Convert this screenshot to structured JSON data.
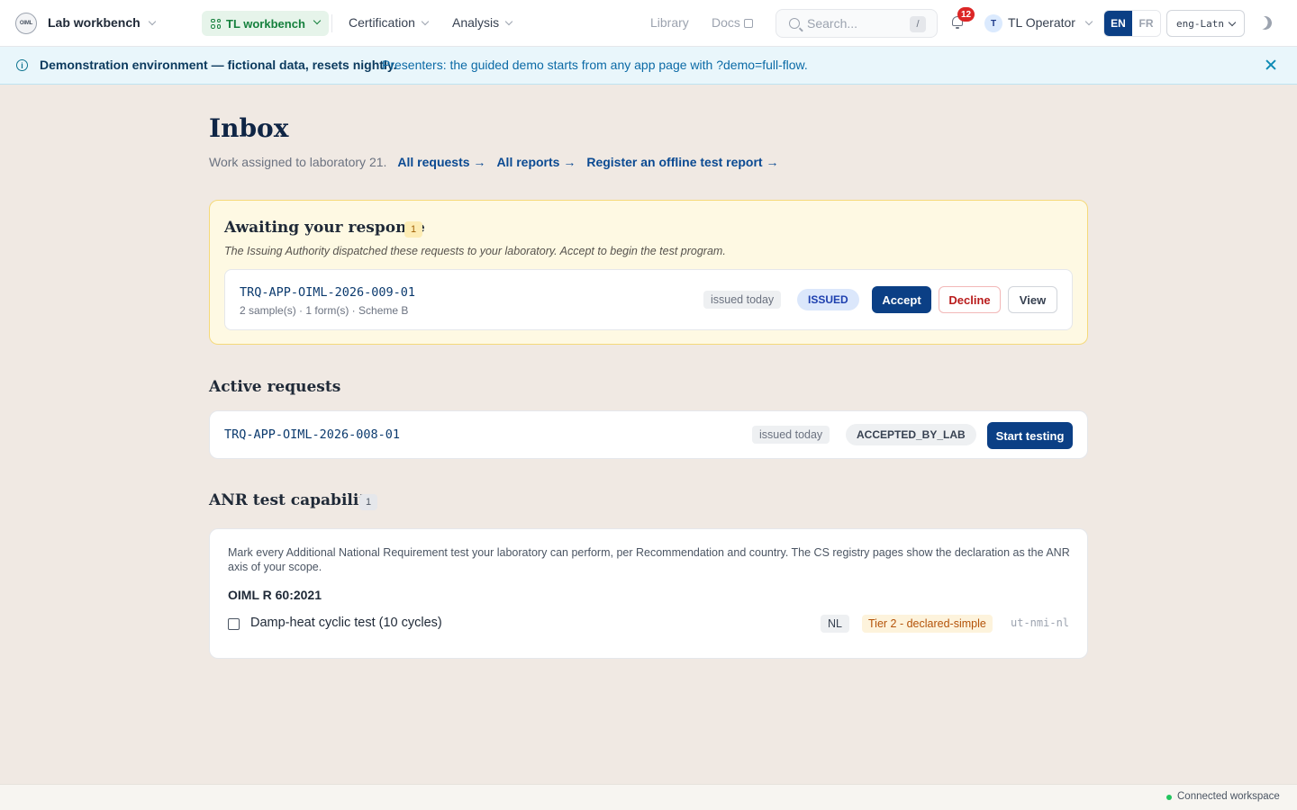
{
  "header": {
    "logo_text": "OIML",
    "app_title": "Lab workbench",
    "workspace_label": "TL workbench",
    "nav": [
      "Certification",
      "Analysis"
    ],
    "links": {
      "library": "Library",
      "docs": "Docs"
    },
    "search_placeholder": "Search...",
    "search_shortcut": "/",
    "notification_count": "12",
    "avatar_initial": "T",
    "user_name": "TL Operator",
    "languages": {
      "active": "EN",
      "inactive": "FR"
    },
    "script_value": "eng-Latn"
  },
  "banner": {
    "strong": "Demonstration environment — fictional data, resets nightly.",
    "text": "Presenters: the guided demo starts from any app page with ?demo=full-flow."
  },
  "page": {
    "title": "Inbox",
    "subtitle": "Work assigned to laboratory 21.",
    "links": [
      "All requests →",
      "All reports →",
      "Register an offline test report →"
    ]
  },
  "awaiting": {
    "title": "Awaiting your response",
    "count": "1",
    "description": "The Issuing Authority dispatched these requests to your laboratory. Accept to begin the test program.",
    "request": {
      "id": "TRQ-APP-OIML-2026-009-01",
      "meta": "2 sample(s) · 1 form(s) · Scheme B",
      "issued": "issued today",
      "status": "ISSUED",
      "actions": {
        "accept": "Accept",
        "decline": "Decline",
        "view": "View"
      }
    }
  },
  "active": {
    "title": "Active requests",
    "request": {
      "id": "TRQ-APP-OIML-2026-008-01",
      "issued": "issued today",
      "status": "ACCEPTED_BY_LAB",
      "action": "Start testing"
    }
  },
  "anr": {
    "title": "ANR test capability",
    "count": "1",
    "description": "Mark every Additional National Requirement test your laboratory can perform, per Recommendation and country. The CS registry pages show the declaration as the ANR axis of your scope.",
    "recommendation": "OIML R 60:2021",
    "test": {
      "label": "Damp-heat cyclic test (10 cycles)",
      "checked": false,
      "country": "NL",
      "tier": "Tier 2 - declared-simple",
      "code": "ut-nmi-nl"
    }
  },
  "footer": {
    "status": "Connected workspace"
  },
  "colors": {
    "brand": "#0b3f85",
    "banner_bg": "#e9f6fb",
    "page_bg": "#f0e9e3",
    "await_bg": "#fef9e3",
    "status_ok": "#22c55e"
  }
}
